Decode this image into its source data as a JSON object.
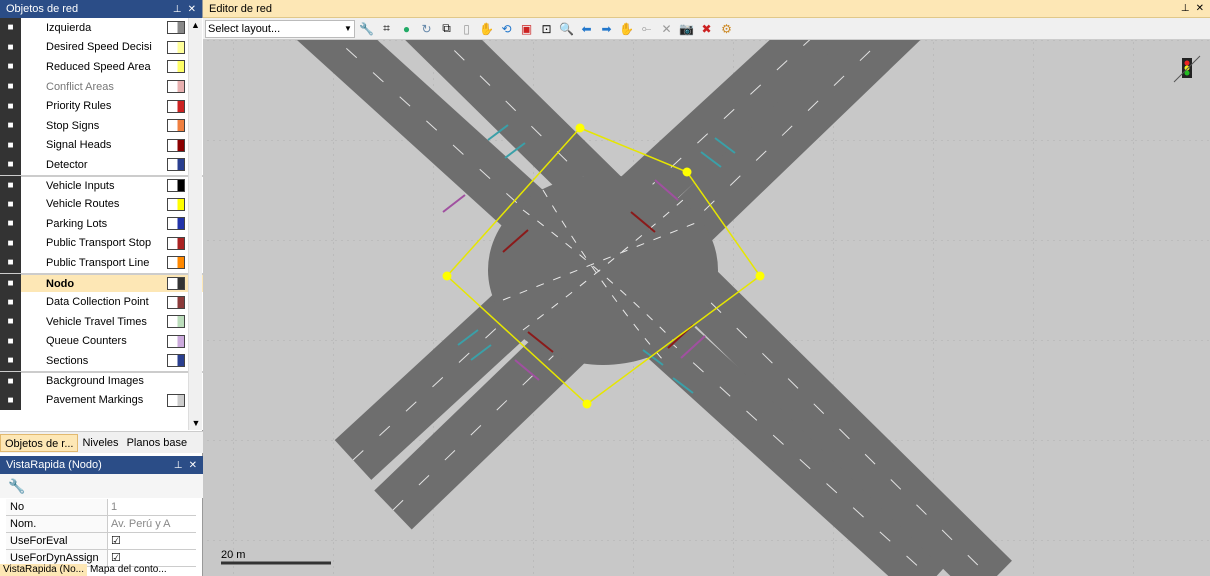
{
  "objects_panel": {
    "title": "Objetos de red",
    "items": [
      {
        "label": "Izquierda",
        "icon": "road-icon",
        "swatch": "#888888"
      },
      {
        "label": "Desired Speed Decisi",
        "icon": "speed-50-icon",
        "swatch": "#ffff99"
      },
      {
        "label": "Reduced Speed Area",
        "icon": "reduced-speed-icon",
        "swatch": "#ffff66"
      },
      {
        "label": "Conflict Areas",
        "icon": "conflict-areas-icon",
        "swatch": "#e8b0b0"
      },
      {
        "label": "Priority Rules",
        "icon": "priority-triangle-icon",
        "swatch": "#cc2222"
      },
      {
        "label": "Stop Signs",
        "icon": "stop-sign-icon",
        "swatch": "#f08040"
      },
      {
        "label": "Signal Heads",
        "icon": "traffic-light-icon",
        "swatch": "#8b0000"
      },
      {
        "label": "Detector",
        "icon": "detector-icon",
        "swatch": "#2a3f8f"
      },
      {
        "label": "Vehicle Inputs",
        "icon": "vehicle-input-icon",
        "swatch": "#000000"
      },
      {
        "label": "Vehicle Routes",
        "icon": "vehicle-routes-icon",
        "swatch": "#ffff00"
      },
      {
        "label": "Parking Lots",
        "icon": "parking-icon",
        "swatch": "#2233aa"
      },
      {
        "label": "Public Transport Stop",
        "icon": "pt-stop-icon",
        "swatch": "#aa2222"
      },
      {
        "label": "Public Transport Line",
        "icon": "pt-line-icon",
        "swatch": "#ff8800"
      },
      {
        "label": "Nodo",
        "icon": "node-icon",
        "swatch": "#333333"
      },
      {
        "label": "Data Collection Point",
        "icon": "data-collection-icon",
        "swatch": "#8b3a3a"
      },
      {
        "label": "Vehicle Travel Times",
        "icon": "stopwatch-icon",
        "swatch": "#bbddbb"
      },
      {
        "label": "Queue Counters",
        "icon": "queue-counter-icon",
        "swatch": "#ccaadd"
      },
      {
        "label": "Sections",
        "icon": "sections-icon",
        "swatch": "#2a3f8f"
      },
      {
        "label": "Background Images",
        "icon": "background-image-icon",
        "swatch": ""
      },
      {
        "label": "Pavement Markings",
        "icon": "pavement-marking-icon",
        "swatch": "#cccccc"
      }
    ],
    "tabs": [
      "Objetos de r...",
      "Niveles",
      "Planos base"
    ]
  },
  "quickview": {
    "title": "VistaRapida (Nodo)",
    "rows": [
      {
        "key": "No",
        "value": "1"
      },
      {
        "key": "Nom.",
        "value": "Av. Perú y A"
      },
      {
        "key": "UseForEval",
        "value": "☑"
      },
      {
        "key": "UseForDynAssign",
        "value": "☑"
      }
    ],
    "tabs": [
      "VistaRapida (No...",
      "Mapa del conto..."
    ]
  },
  "editor": {
    "title": "Editor de red",
    "layout_placeholder": "Select layout...",
    "scale_label": "20 m"
  },
  "colors": {
    "canvas": "#c8c8c8",
    "road": "#6e6e6e",
    "node_polygon": "#ffff00",
    "accent": "#fde7b5"
  }
}
